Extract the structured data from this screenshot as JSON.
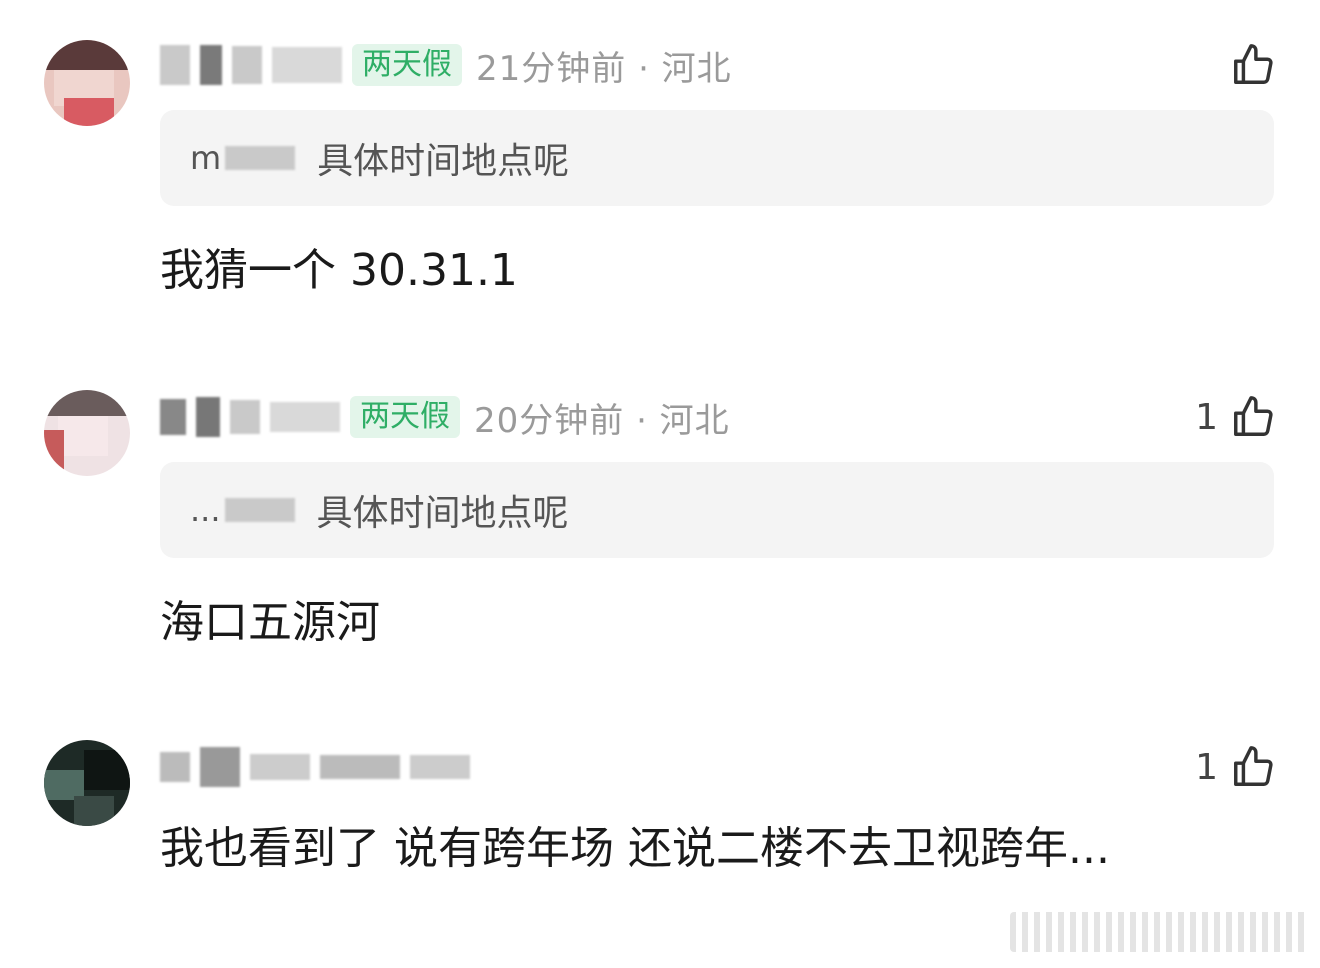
{
  "comments": [
    {
      "tag": "两天假",
      "meta": "21分钟前 · 河北",
      "likes": "",
      "quote_name": "m",
      "quote_text": "具体时间地点呢",
      "body": "我猜一个 30.31.1"
    },
    {
      "tag": "两天假",
      "meta": "20分钟前 · 河北",
      "likes": "1",
      "quote_name": "...",
      "quote_text": "具体时间地点呢",
      "body": "海口五源河"
    },
    {
      "likes": "1",
      "body": "我也看到了 说有跨年场 还说二楼不去卫视跨年..."
    }
  ],
  "icons": {
    "like": "thumbs-up-icon"
  },
  "colors": {
    "tag_bg": "#e3f5ea",
    "tag_fg": "#2fae66",
    "meta": "#9a9a9a",
    "quote_bg": "#f4f4f4"
  }
}
